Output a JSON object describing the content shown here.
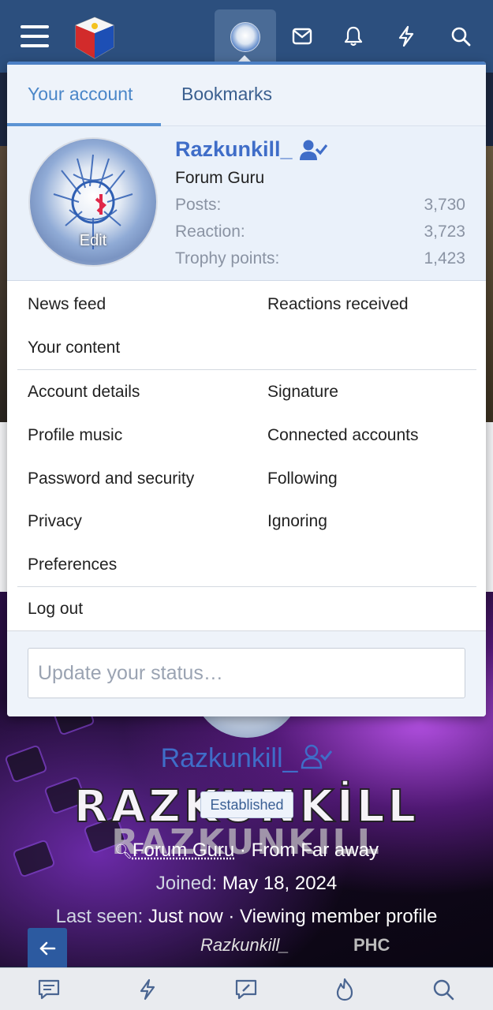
{
  "header": {
    "icons": [
      "menu-icon",
      "site-logo",
      "account-avatar",
      "inbox-icon",
      "bell-icon",
      "bolt-icon",
      "search-icon"
    ]
  },
  "dropdown": {
    "tabs": [
      {
        "label": "Your account",
        "active": true
      },
      {
        "label": "Bookmarks",
        "active": false
      }
    ],
    "profile": {
      "username": "Razkunkill_",
      "title": "Forum Guru",
      "avatar_edit": "Edit",
      "stats": [
        {
          "label": "Posts:",
          "value": "3,730"
        },
        {
          "label": "Reaction:",
          "value": "3,723"
        },
        {
          "label": "Trophy points:",
          "value": "1,423"
        }
      ]
    },
    "menu_group_1": [
      "News feed",
      "Reactions received",
      "Your content"
    ],
    "menu_group_2": [
      "Account details",
      "Signature",
      "Profile music",
      "Connected accounts",
      "Password and security",
      "Following",
      "Privacy",
      "Ignoring",
      "Preferences"
    ],
    "logout": "Log out",
    "status_placeholder": "Update your status…"
  },
  "cover": {
    "username": "Razkunkill_",
    "banner_text": "RAZKUNKİLL",
    "banner_text_2": "RAZKUNKILL",
    "badge": "Established",
    "title_line_title": "Forum Guru",
    "title_line_location": " · From Far away",
    "joined_label": "Joined:",
    "joined_value": "May 18, 2024",
    "last_seen_label": "Last seen:",
    "last_seen_value": "Just now · Viewing member profile",
    "signature": "Razkunkill_",
    "signature_tag": "PHC"
  },
  "bottom_nav": [
    "forums-icon",
    "whats-new-icon",
    "new-post-icon",
    "trending-icon",
    "search-icon"
  ],
  "colors": {
    "header_bg": "#2c4f7e",
    "accent": "#3f6dc8",
    "tab_active": "#4a86c8"
  }
}
